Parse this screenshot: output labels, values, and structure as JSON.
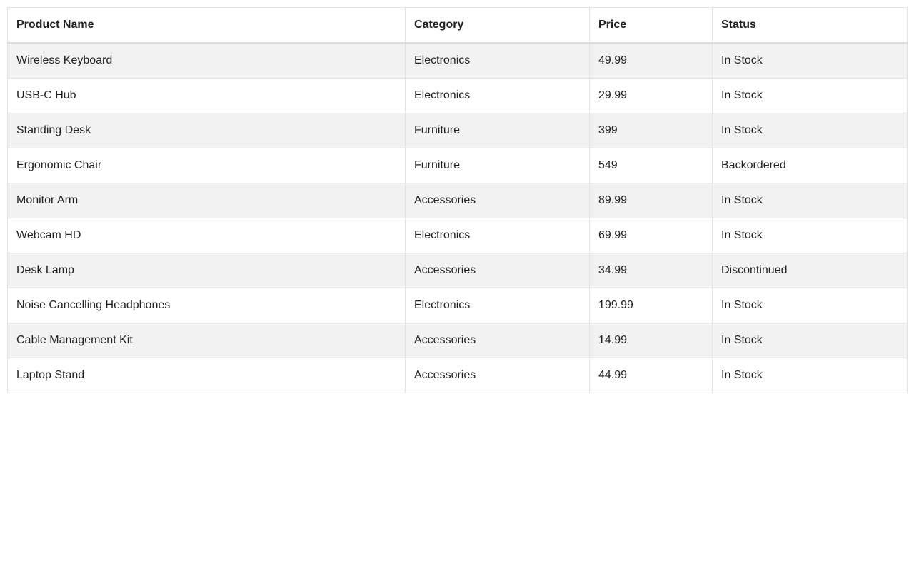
{
  "table": {
    "headers": {
      "product_name": "Product Name",
      "category": "Category",
      "price": "Price",
      "status": "Status"
    },
    "rows": [
      {
        "product_name": "Wireless Keyboard",
        "category": "Electronics",
        "price": "49.99",
        "status": "In Stock"
      },
      {
        "product_name": "USB-C Hub",
        "category": "Electronics",
        "price": "29.99",
        "status": "In Stock"
      },
      {
        "product_name": "Standing Desk",
        "category": "Furniture",
        "price": "399",
        "status": "In Stock"
      },
      {
        "product_name": "Ergonomic Chair",
        "category": "Furniture",
        "price": "549",
        "status": "Backordered"
      },
      {
        "product_name": "Monitor Arm",
        "category": "Accessories",
        "price": "89.99",
        "status": "In Stock"
      },
      {
        "product_name": "Webcam HD",
        "category": "Electronics",
        "price": "69.99",
        "status": "In Stock"
      },
      {
        "product_name": "Desk Lamp",
        "category": "Accessories",
        "price": "34.99",
        "status": "Discontinued"
      },
      {
        "product_name": "Noise Cancelling Headphones",
        "category": "Electronics",
        "price": "199.99",
        "status": "In Stock"
      },
      {
        "product_name": "Cable Management Kit",
        "category": "Accessories",
        "price": "14.99",
        "status": "In Stock"
      },
      {
        "product_name": "Laptop Stand",
        "category": "Accessories",
        "price": "44.99",
        "status": "In Stock"
      }
    ]
  }
}
